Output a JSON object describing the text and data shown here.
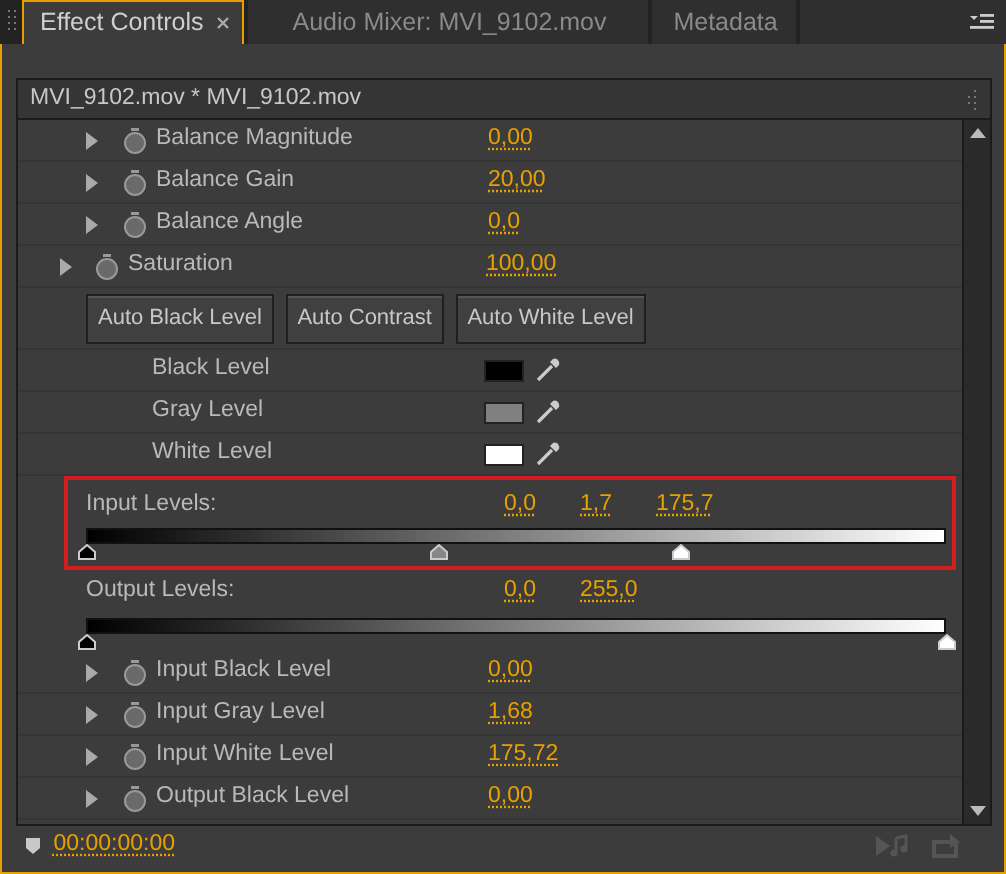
{
  "tabs": [
    {
      "label": "Effect Controls",
      "selected": true,
      "closable": true
    },
    {
      "label": "Audio Mixer: MVI_9102.mov",
      "selected": false,
      "closable": false
    },
    {
      "label": "Metadata",
      "selected": false,
      "closable": false
    }
  ],
  "clip_header": "MVI_9102.mov * MVI_9102.mov",
  "rows": [
    {
      "kind": "sub",
      "label": "Balance Magnitude",
      "value": "0,00",
      "expanded": false
    },
    {
      "kind": "sub",
      "label": "Balance Gain",
      "value": "20,00",
      "expanded": false
    },
    {
      "kind": "sub",
      "label": "Balance Angle",
      "value": "0,0",
      "expanded": false
    },
    {
      "kind": "param",
      "label": "Saturation",
      "value": "100,00",
      "expanded": false
    },
    {
      "kind": "buttons",
      "buttons": [
        "Auto Black Level",
        "Auto Contrast",
        "Auto White Level"
      ]
    },
    {
      "kind": "swatch",
      "label": "Black Level",
      "color": "#000000"
    },
    {
      "kind": "swatch",
      "label": "Gray Level",
      "color": "#808080"
    },
    {
      "kind": "swatch",
      "label": "White Level",
      "color": "#ffffff"
    },
    {
      "kind": "levels",
      "label": "Input Levels:",
      "highlighted": true,
      "values": [
        "0,0",
        "1,7",
        "175,7"
      ],
      "handles": [
        {
          "level": 0
        },
        {
          "level": 0.41
        },
        {
          "level": 0.69
        }
      ]
    },
    {
      "kind": "levels",
      "label": "Output Levels:",
      "highlighted": false,
      "values": [
        "0,0",
        "255,0"
      ],
      "handles": [
        {
          "level": 0
        },
        {
          "level": 1
        }
      ]
    },
    {
      "kind": "sub",
      "label": "Input Black Level",
      "value": "0,00",
      "expanded": false
    },
    {
      "kind": "sub",
      "label": "Input Gray Level",
      "value": "1,68",
      "expanded": false
    },
    {
      "kind": "sub",
      "label": "Input White Level",
      "value": "175,72",
      "expanded": false
    },
    {
      "kind": "sub",
      "label": "Output Black Level",
      "value": "0,00",
      "expanded": false
    }
  ],
  "timecode": "00:00:00:00"
}
